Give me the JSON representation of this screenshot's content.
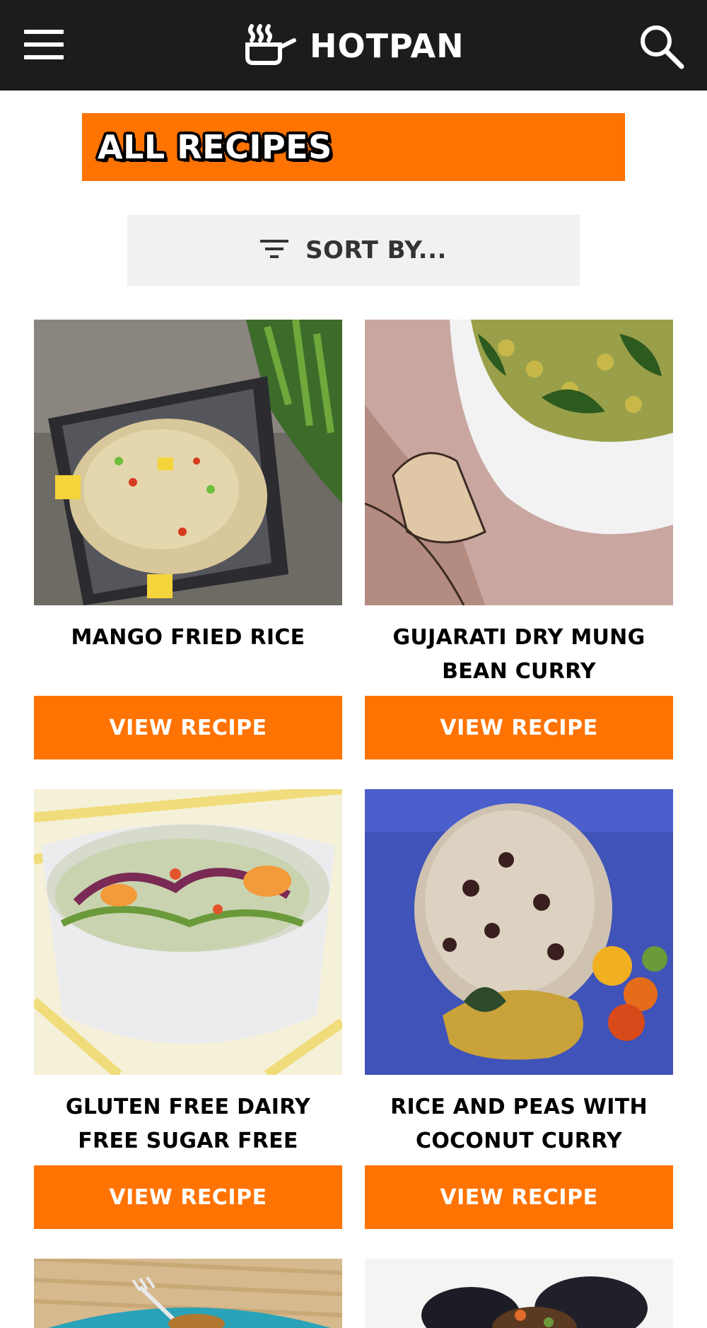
{
  "header": {
    "brand": "HOTPAN",
    "menu_icon": "hamburger-menu-icon",
    "search_icon": "search-icon",
    "logo_icon": "steaming-pot-icon"
  },
  "page": {
    "title": "ALL RECIPES",
    "sort_label": "SORT BY...",
    "sort_icon": "filter-lines-icon"
  },
  "colors": {
    "accent": "#ff7302",
    "header_bg": "#1c1c1c",
    "sort_bg": "#f1f1f1"
  },
  "recipes": [
    {
      "name": "MANGO FRIED RICE",
      "button": "VIEW RECIPE",
      "image": "mango fried rice in a dark square bowl"
    },
    {
      "name": "GUJARATI DRY MUNG BEAN CURRY",
      "button": "VIEW RECIPE",
      "image": "mung bean curry in a white bowl"
    },
    {
      "name": "GLUTEN FREE DAIRY FREE SUGAR FREE",
      "button": "VIEW RECIPE",
      "image": "slaw salad in a white bowl"
    },
    {
      "name": "RICE AND PEAS WITH COCONUT CURRY",
      "button": "VIEW RECIPE",
      "image": "rice and peas on a blue plate"
    },
    {
      "name": "",
      "button": "",
      "image": "dessert on a blue plate"
    },
    {
      "name": "",
      "button": "",
      "image": "mussels in a bowl"
    }
  ]
}
